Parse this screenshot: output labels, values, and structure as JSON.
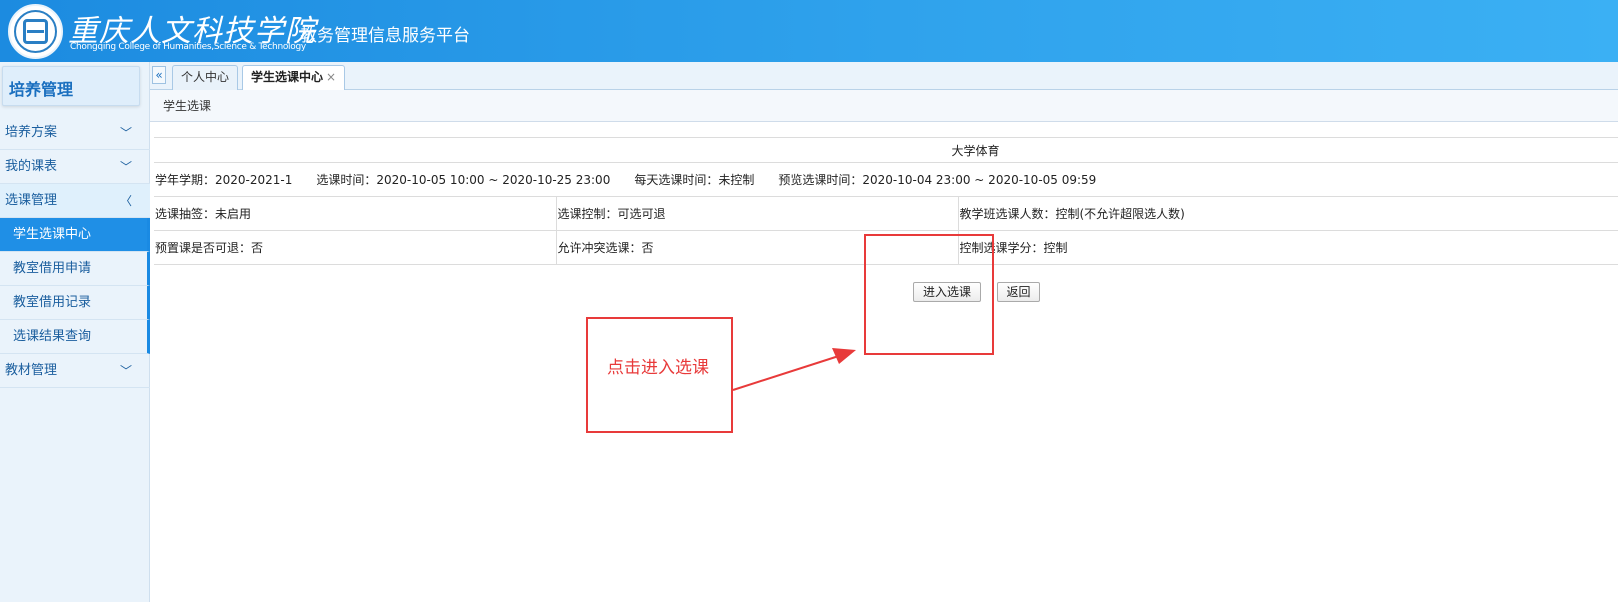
{
  "header": {
    "school_name_cn": "重庆人文科技学院",
    "school_name_en": "Chongqing College of Humanities,Science & Technology",
    "platform_title": "教务管理信息服务平台"
  },
  "sidebar": {
    "title": "培养管理",
    "items": [
      {
        "label": "培养方案"
      },
      {
        "label": "我的课表"
      },
      {
        "label": "选课管理"
      },
      {
        "label": "教材管理"
      }
    ],
    "subitems": [
      {
        "label": "学生选课中心"
      },
      {
        "label": "教室借用申请"
      },
      {
        "label": "教室借用记录"
      },
      {
        "label": "选课结果查询"
      }
    ]
  },
  "tabs": {
    "collapse_glyph": "«",
    "items": [
      {
        "label": "个人中心"
      },
      {
        "label": "学生选课中心",
        "close": "×"
      }
    ]
  },
  "page": {
    "breadcrumb": "学生选课",
    "course_title": "大学体育",
    "term": "学年学期：2020-2021-1",
    "select_time": "选课时间：2020-10-05 10:00 ~ 2020-10-25 23:00",
    "daily_time": "每天选课时间：未控制",
    "preview_time": "预览选课时间：2020-10-04 23:00 ~ 2020-10-05 09:59",
    "lottery": "选课抽签：未启用",
    "control": "选课控制：可选可退",
    "class_count": "教学班选课人数：控制(不允许超限选人数)",
    "preset_drop": "预置课是否可退：否",
    "conflict": "允许冲突选课：否",
    "credit_control": "控制选课学分：控制",
    "enter_button": "进入选课",
    "back_button": "返回"
  },
  "annotation": {
    "text": "点击进入选课",
    "color": "#e83a3a"
  }
}
